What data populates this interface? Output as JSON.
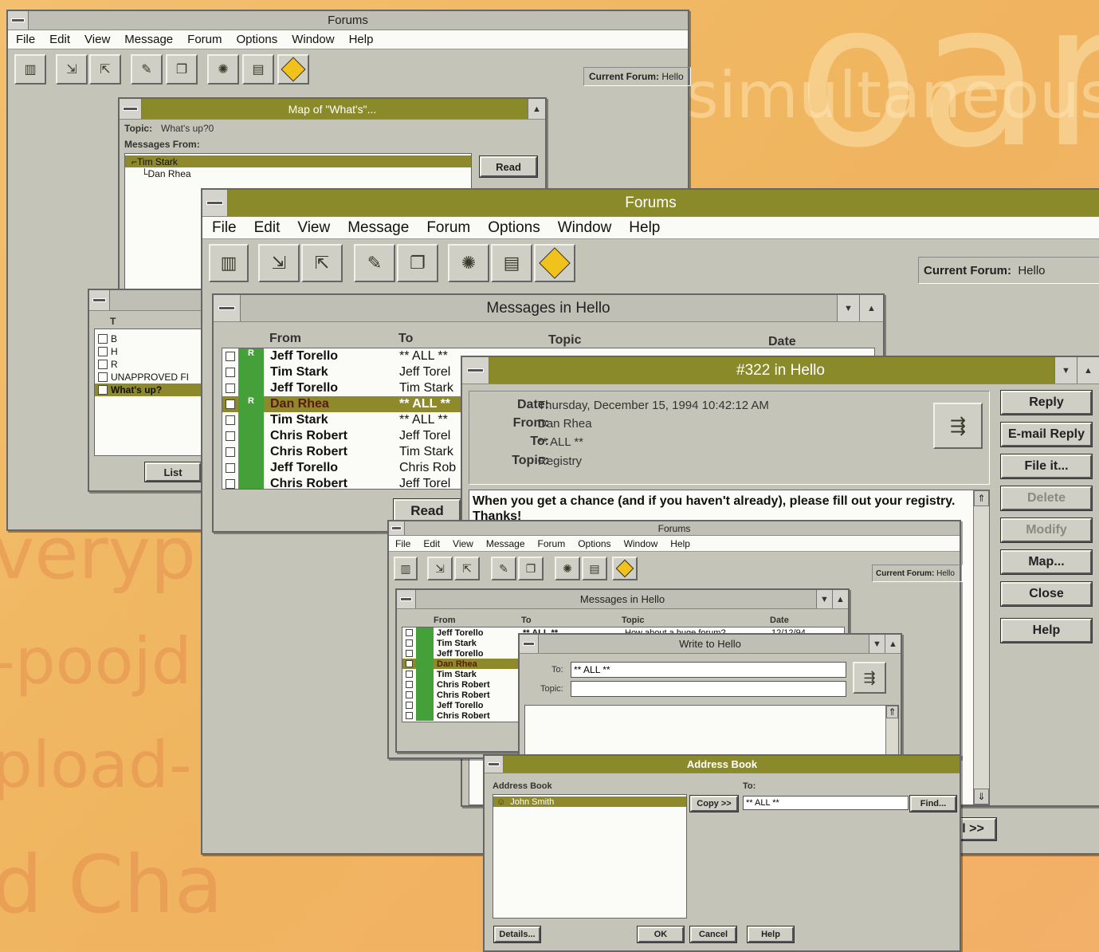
{
  "win_back": {
    "title": "Forums",
    "menu": [
      "File",
      "Edit",
      "View",
      "Message",
      "Forum",
      "Options",
      "Window",
      "Help"
    ],
    "current_forum_label": "Current Forum:",
    "current_forum_value": "Hello"
  },
  "map_window": {
    "title": "Map of \"What's\"...",
    "topic_label": "Topic:",
    "topic_value": "What's up?0",
    "messages_from_label": "Messages From:",
    "tree": [
      "Tim Stark",
      "Dan Rhea"
    ],
    "read_button": "Read"
  },
  "left_list_window": {
    "items": [
      "B",
      "H",
      "R",
      "UNAPPROVED FI",
      "What's up?"
    ],
    "header_partial": "T",
    "list_button": "List"
  },
  "win_main": {
    "title": "Forums",
    "menu": [
      "File",
      "Edit",
      "View",
      "Message",
      "Forum",
      "Options",
      "Window",
      "Help"
    ],
    "current_forum_label": "Current Forum:",
    "current_forum_value": "Hello"
  },
  "messages_window": {
    "title": "Messages in Hello",
    "columns": {
      "from": "From",
      "to": "To",
      "topic": "Topic",
      "date": "Date"
    },
    "rows": [
      {
        "flag": "R",
        "from": "Jeff Torello",
        "to": "** ALL **"
      },
      {
        "flag": "",
        "from": "Tim Stark",
        "to": "Jeff Torel"
      },
      {
        "flag": "",
        "from": "Jeff Torello",
        "to": "Tim Stark"
      },
      {
        "flag": "R",
        "from": "Dan Rhea",
        "to": "** ALL **"
      },
      {
        "flag": "",
        "from": "Tim Stark",
        "to": "** ALL **"
      },
      {
        "flag": "",
        "from": "Chris Robert",
        "to": "Jeff Torel"
      },
      {
        "flag": "",
        "from": "Chris Robert",
        "to": "Tim Stark"
      },
      {
        "flag": "",
        "from": "Jeff Torello",
        "to": "Chris Rob"
      },
      {
        "flag": "",
        "from": "Chris Robert",
        "to": "Jeff Torel"
      }
    ],
    "read_button": "Read"
  },
  "message_window": {
    "title": "#322 in Hello",
    "date_label": "Date:",
    "date_value": "Thursday, December 15, 1994   10:42:12 AM",
    "from_label": "From:",
    "from_value": "Dan Rhea",
    "to_label": "To:",
    "to_value": "** ALL **",
    "topic_label": "Topic:",
    "topic_value": "Registry",
    "body": "When you get a chance (and if you haven't already), please fill out your registry.  Thanks!",
    "buttons": {
      "reply": "Reply",
      "email_reply": "E-mail Reply",
      "file_it": "File it...",
      "delete": "Delete",
      "modify": "Modify",
      "map": "Map...",
      "close": "Close",
      "help": "Help"
    },
    "partial_button": "l >>"
  },
  "win_small": {
    "title": "Forums",
    "menu": [
      "File",
      "Edit",
      "View",
      "Message",
      "Forum",
      "Options",
      "Window",
      "Help"
    ],
    "current_forum_label": "Current Forum:",
    "current_forum_value": "Hello"
  },
  "small_messages": {
    "title": "Messages in Hello",
    "columns": {
      "from": "From",
      "to": "To",
      "topic": "Topic",
      "date": "Date"
    },
    "rows": [
      "Jeff Torello",
      "Tim Stark",
      "Jeff Torello",
      "Dan Rhea",
      "Tim Stark",
      "Chris Robert",
      "Chris Robert",
      "Jeff Torello",
      "Chris Robert"
    ],
    "first_row_to": "** ALL **",
    "first_row_topic": "How about a huge forum?",
    "first_row_date": "12/12/94"
  },
  "write_window": {
    "title": "Write to Hello",
    "to_label": "To:",
    "to_value": "** ALL **",
    "topic_label": "Topic:",
    "topic_value": ""
  },
  "address_book": {
    "title": "Address Book",
    "list_label": "Address Book",
    "to_label": "To:",
    "entries": [
      "John Smith"
    ],
    "to_value": "** ALL **",
    "buttons": {
      "copy": "Copy >>",
      "find": "Find...",
      "details": "Details...",
      "ok": "OK",
      "cancel": "Cancel",
      "help": "Help"
    }
  }
}
